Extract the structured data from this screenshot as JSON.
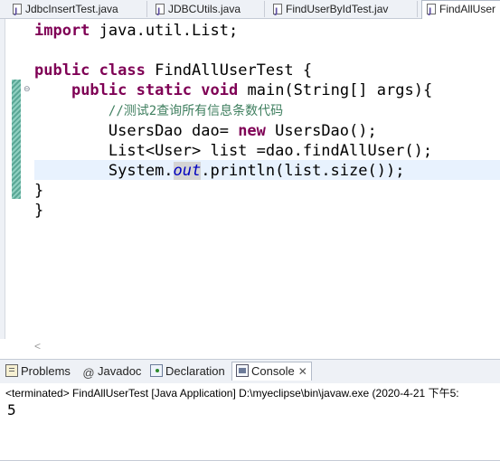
{
  "editor_tabs": [
    {
      "label": "JdbcInsertTest.java",
      "active": false
    },
    {
      "label": "JDBCUtils.java",
      "active": false
    },
    {
      "label": "FindUserByIdTest.jav",
      "active": false
    },
    {
      "label": "FindAllUser",
      "active": true
    }
  ],
  "code": {
    "line1": {
      "kw": "import",
      "rest": " java.util.List;"
    },
    "line3": {
      "kw1": "public",
      "kw2": "class",
      "rest": " FindAllUserTest {"
    },
    "line4": {
      "kw1": "public",
      "kw2": "static",
      "kw3": "void",
      "rest": " main(String[] args){"
    },
    "line5": {
      "comment": "//测试2查询所有信息条数代码"
    },
    "line6": {
      "pre": "UsersDao dao= ",
      "kw": "new",
      "rest": " UsersDao();"
    },
    "line7": {
      "text": "List<User> list =dao.findAllUser();"
    },
    "line8": {
      "pre": "System.",
      "field": "out",
      "rest": ".println(list.size());"
    },
    "line9": {
      "text": "}"
    },
    "line10": {
      "text": "}"
    }
  },
  "view_tabs": [
    {
      "label": "Problems",
      "icon": "problems-icon",
      "active": false
    },
    {
      "label": "Javadoc",
      "icon": "at-icon",
      "active": false
    },
    {
      "label": "Declaration",
      "icon": "declaration-icon",
      "active": false
    },
    {
      "label": "Console",
      "icon": "console-icon",
      "active": true
    }
  ],
  "console": {
    "status": "<terminated> FindAllUserTest [Java Application] D:\\myeclipse\\bin\\javaw.exe (2020-4-21 下午5:",
    "output": "5"
  },
  "colors": {
    "keyword": "#7f0055",
    "comment": "#3f7f5f",
    "field": "#0000c0",
    "current_line": "#e8f2fe",
    "change_bar": "#5aa796"
  }
}
